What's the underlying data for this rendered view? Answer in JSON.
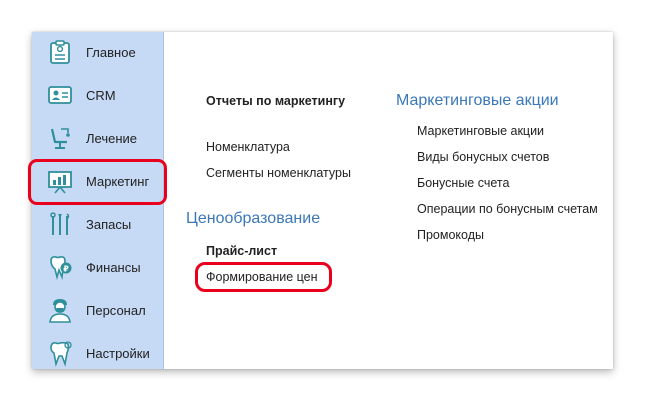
{
  "sidebar": {
    "items": [
      {
        "label": "Главное",
        "icon": "checklist-icon"
      },
      {
        "label": "CRM",
        "icon": "contact-card-icon"
      },
      {
        "label": "Лечение",
        "icon": "dental-chair-icon"
      },
      {
        "label": "Маркетинг",
        "icon": "presentation-board-icon"
      },
      {
        "label": "Запасы",
        "icon": "dental-tools-icon"
      },
      {
        "label": "Финансы",
        "icon": "tooth-coin-icon"
      },
      {
        "label": "Персонал",
        "icon": "doctor-icon"
      },
      {
        "label": "Настройки",
        "icon": "tooth-icon"
      }
    ],
    "selected": "Маркетинг"
  },
  "content": {
    "reports_link": "Отчеты по маркетингу",
    "nomenclature": "Номенклатура",
    "nomenclature_segments": "Сегменты номенклатуры",
    "pricing_section": "Ценообразование",
    "price_list": "Прайс-лист",
    "price_forming": "Формирование цен",
    "promo_section": "Маркетинговые акции",
    "promo_links": [
      "Маркетинговые акции",
      "Виды бонусных счетов",
      "Бонусные счета",
      "Операции по бонусным счетам",
      "Промокоды"
    ]
  },
  "colors": {
    "sidebar_bg": "#c6daf5",
    "section_title": "#3a78b8",
    "highlight": "#e8001c",
    "icon_teal": "#2f8f9b"
  }
}
